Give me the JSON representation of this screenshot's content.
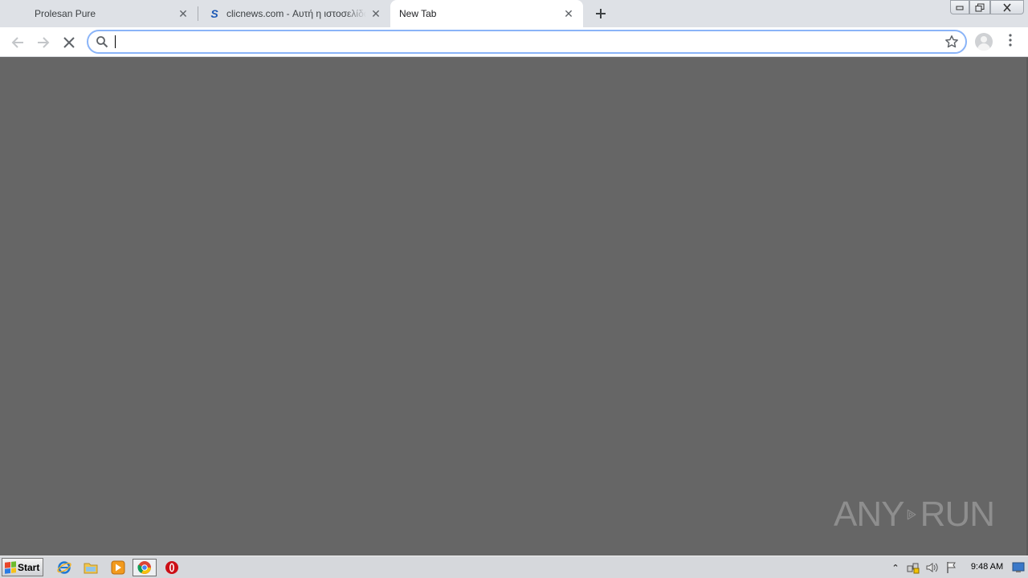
{
  "browser": {
    "tabs": [
      {
        "title": "Prolesan Pure",
        "active": false
      },
      {
        "title": "clicnews.com - Αυτή η ιστοσελίδα είναι",
        "favicon": "S",
        "active": false
      },
      {
        "title": "New Tab",
        "active": true
      }
    ],
    "new_tab_icon": "plus-icon",
    "window_controls": {
      "minimize": "—",
      "restore": "❐",
      "close": "✕"
    },
    "toolbar": {
      "back_icon": "←",
      "forward_icon": "→",
      "stop_icon": "✕",
      "omnibox_value": "",
      "bookmark_icon": "☆",
      "menu_icon": "⋮"
    }
  },
  "watermark": {
    "left": "ANY",
    "right": "RUN"
  },
  "taskbar": {
    "start_label": "Start",
    "pinned": [
      "internet-explorer-icon",
      "windows-explorer-icon",
      "media-player-icon",
      "chrome-icon",
      "opera-icon"
    ],
    "tray_expand": "⌃",
    "clock": "9:48 AM"
  },
  "colors": {
    "tabstrip": "#dee1e6",
    "content_background": "#666666",
    "omnibox_focus": "#8ab4f8",
    "taskbar": "#d6d8dc"
  }
}
